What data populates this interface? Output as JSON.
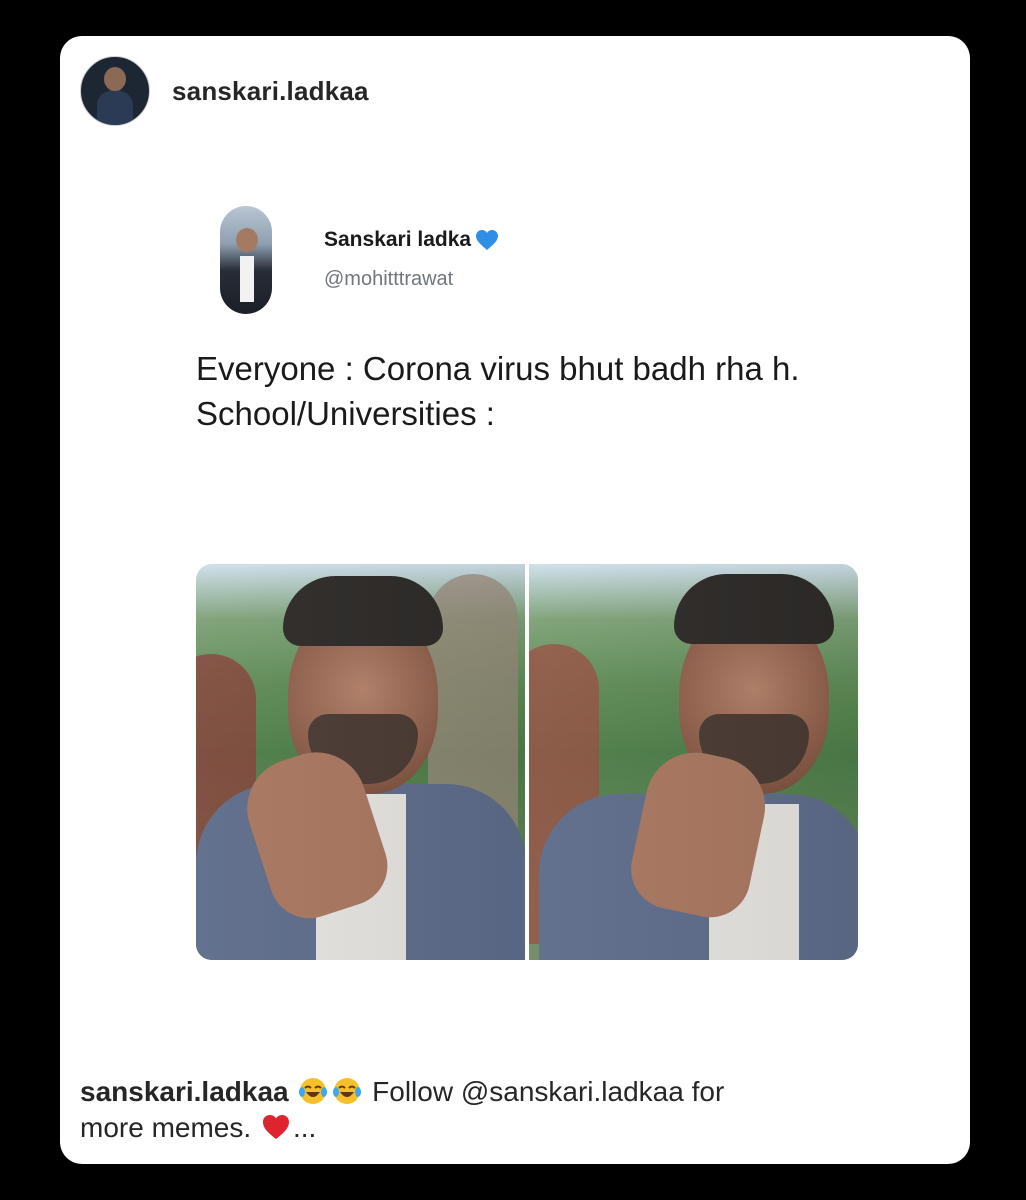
{
  "post": {
    "username": "sanskari.ladkaa"
  },
  "tweet": {
    "display_name": "Sanskari ladka",
    "verified_icon": "blue-heart-icon",
    "handle": "@mohitttrawat",
    "text": "Everyone : Corona virus bhut badh rha h.\nSchool/Universities :"
  },
  "caption": {
    "username": "sanskari.ladkaa",
    "emojis": [
      "laughing-tears-icon",
      "laughing-tears-icon"
    ],
    "text_1": "Follow @sanskari.ladkaa for",
    "text_2": "more memes.",
    "heart_icon": "red-heart-icon",
    "ellipsis": "..."
  },
  "colors": {
    "background": "#000000",
    "card": "#ffffff",
    "handle_gray": "#70767c",
    "blue_heart": "#2f8fe6",
    "red_heart": "#e0242f"
  }
}
